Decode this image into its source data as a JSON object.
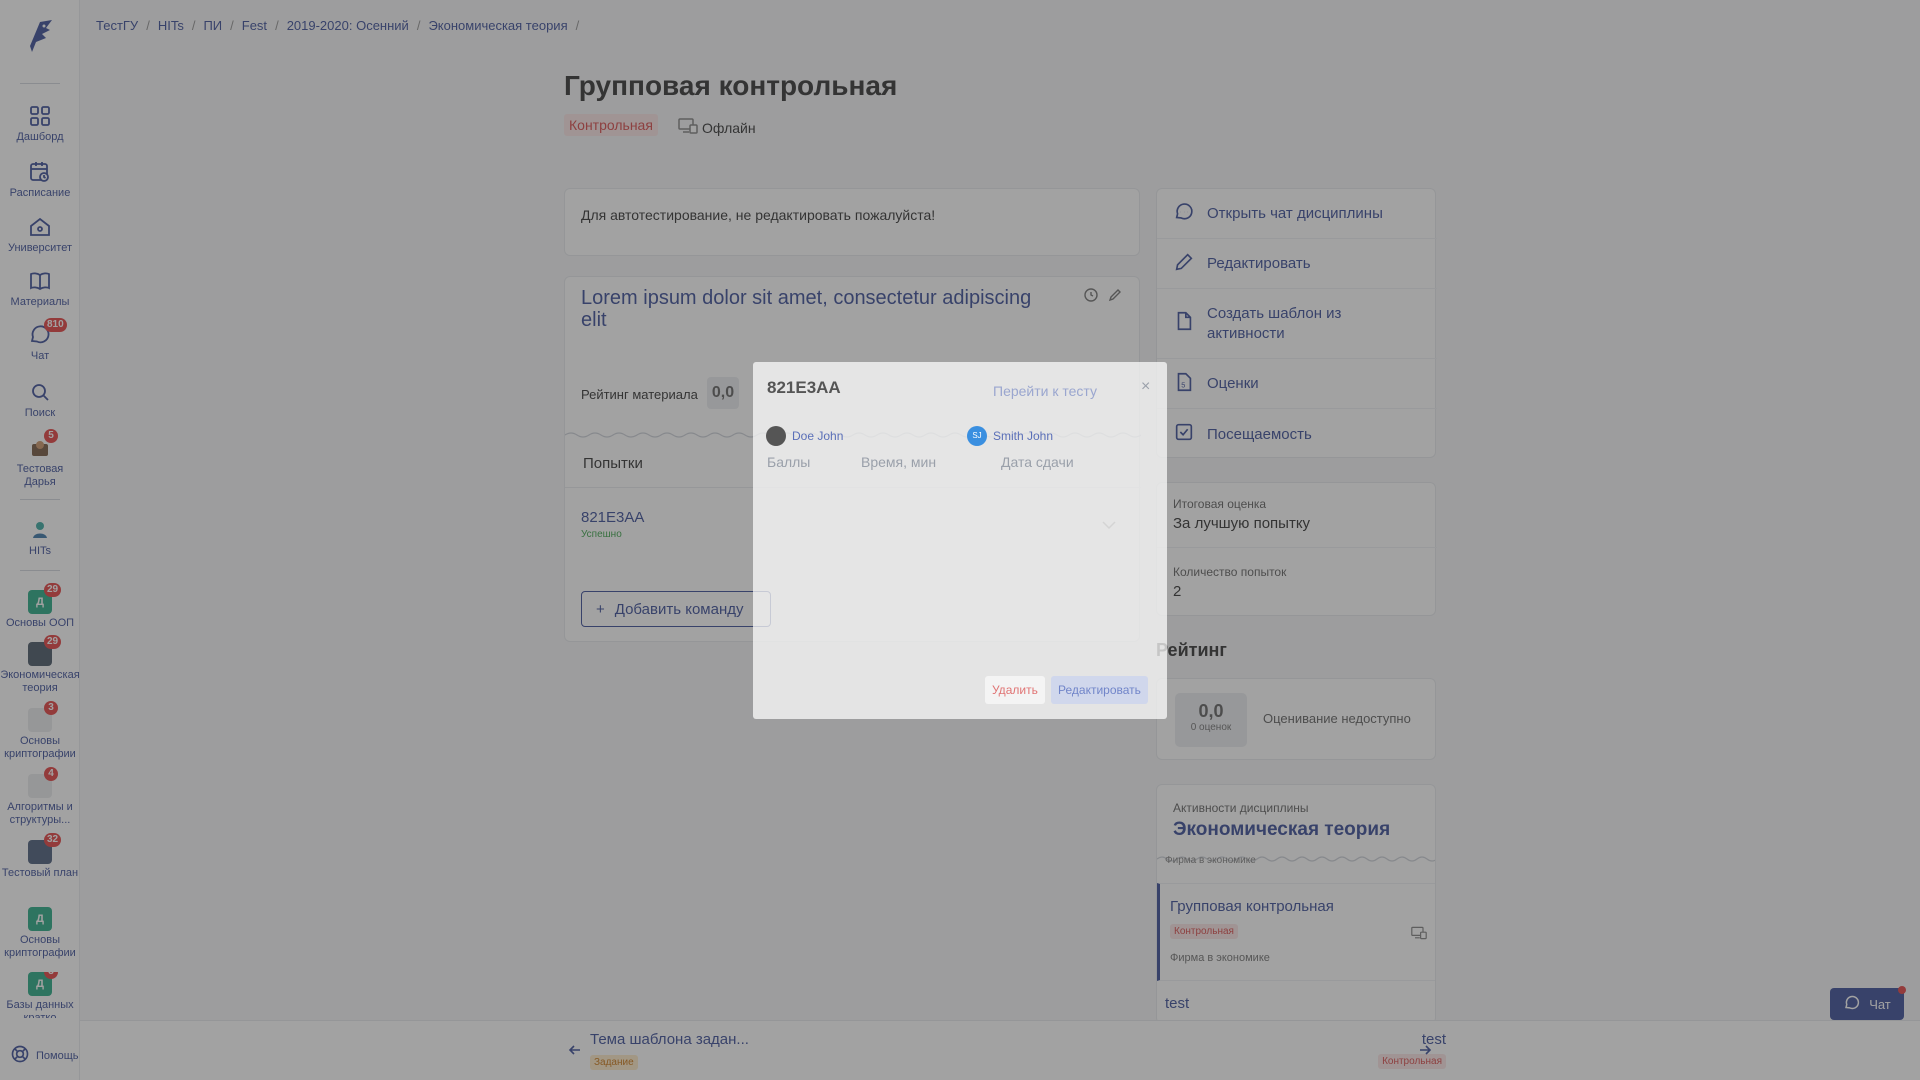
{
  "breadcrumb": [
    "ТестГУ",
    "HITs",
    "ПИ",
    "Fest",
    "2019-2020: Осенний",
    "Экономическая теория"
  ],
  "page": {
    "title": "Групповая контрольная",
    "type_tag": "Контрольная",
    "mode": "Офлайн",
    "description": "Для автотестирование, не редактировать пожалуйста!"
  },
  "material": {
    "title": "Lorem ipsum dolor sit amet, consectetur adipiscing elit",
    "rating_label": "Рейтинг материала",
    "rating_value": "0,0",
    "attempts_header": "Попытки",
    "attempt_name": "821E3AA",
    "attempt_status": "Успешно",
    "add_team_label": "Добавить команду"
  },
  "sidebar": {
    "items": [
      {
        "label": "Дашборд",
        "icon": "grid-icon"
      },
      {
        "label": "Расписание",
        "icon": "calendar-icon"
      },
      {
        "label": "Университет",
        "icon": "home-icon"
      },
      {
        "label": "Материалы",
        "icon": "book-icon"
      },
      {
        "label": "Чат",
        "icon": "chat-icon",
        "badge": "810"
      },
      {
        "label": "Поиск",
        "icon": "search-icon"
      },
      {
        "label": "Тестовая Дарья",
        "badge": "5"
      },
      {
        "label": "HITs"
      }
    ],
    "courses": [
      {
        "label": "Основы ООП",
        "badge": "29",
        "letter": "Д",
        "color": "#17a27a"
      },
      {
        "label": "Экономическая теория",
        "badge": "29",
        "letter": "",
        "color": "#3b4a5a"
      },
      {
        "label": "Основы криптографии",
        "badge": "3",
        "letter": "",
        "color": "#6a6f78"
      },
      {
        "label": "Алгоритмы и структуры...",
        "badge": "4",
        "letter": "",
        "color": "#a84040"
      },
      {
        "label": "Тестовый план",
        "badge": "32",
        "letter": "",
        "color": "#3c5070"
      },
      {
        "label": "Основы криптографии",
        "badge": "",
        "letter": "Д",
        "color": "#17a27a"
      },
      {
        "label": "Базы данных кратко",
        "badge": "3",
        "letter": "Д",
        "color": "#17a27a"
      }
    ],
    "help_label": "Помощь"
  },
  "actions": [
    {
      "label": "Открыть чат дисциплины",
      "icon": "chat-icon"
    },
    {
      "label": "Редактировать",
      "icon": "pencil-icon"
    },
    {
      "label": "Создать шаблон из активности",
      "icon": "file-icon"
    },
    {
      "label": "Оценки",
      "icon": "grades-icon"
    },
    {
      "label": "Посещаемость",
      "icon": "checkbox-icon"
    }
  ],
  "info": {
    "final_grade_label": "Итоговая оценка",
    "final_grade_value": "За лучшую попытку",
    "attempts_count_label": "Количество попыток",
    "attempts_count_value": "2"
  },
  "rating": {
    "header": "Рейтинг",
    "score": "0,0",
    "count": "0 оценок",
    "status": "Оценивание недоступно"
  },
  "discipline": {
    "label": "Активности дисциплины",
    "name": "Экономическая теория",
    "faded_text": "Фирма в экономике",
    "active_title": "Групповая контрольная",
    "active_tag": "Контрольная",
    "active_sub": "Фирма в экономике",
    "next_title": "test"
  },
  "bottom_nav": {
    "prev_title": "Тема шаблона задан...",
    "prev_tag": "Задание",
    "next_title": "test",
    "next_tag": "Контрольная"
  },
  "chat_button": "Чат",
  "modal": {
    "title": "821E3AA",
    "goto_label": "Перейти к тесту",
    "close": "×",
    "users": [
      "Doe John",
      "Smith John"
    ],
    "user2_initials": "SJ",
    "columns": [
      "Баллы",
      "Время, мин",
      "Дата сдачи"
    ],
    "delete_label": "Удалить",
    "edit_label": "Редактировать"
  },
  "colors": {
    "accent": "#2b3f8f",
    "danger": "#d43a3a",
    "success": "#2a9a3a"
  }
}
